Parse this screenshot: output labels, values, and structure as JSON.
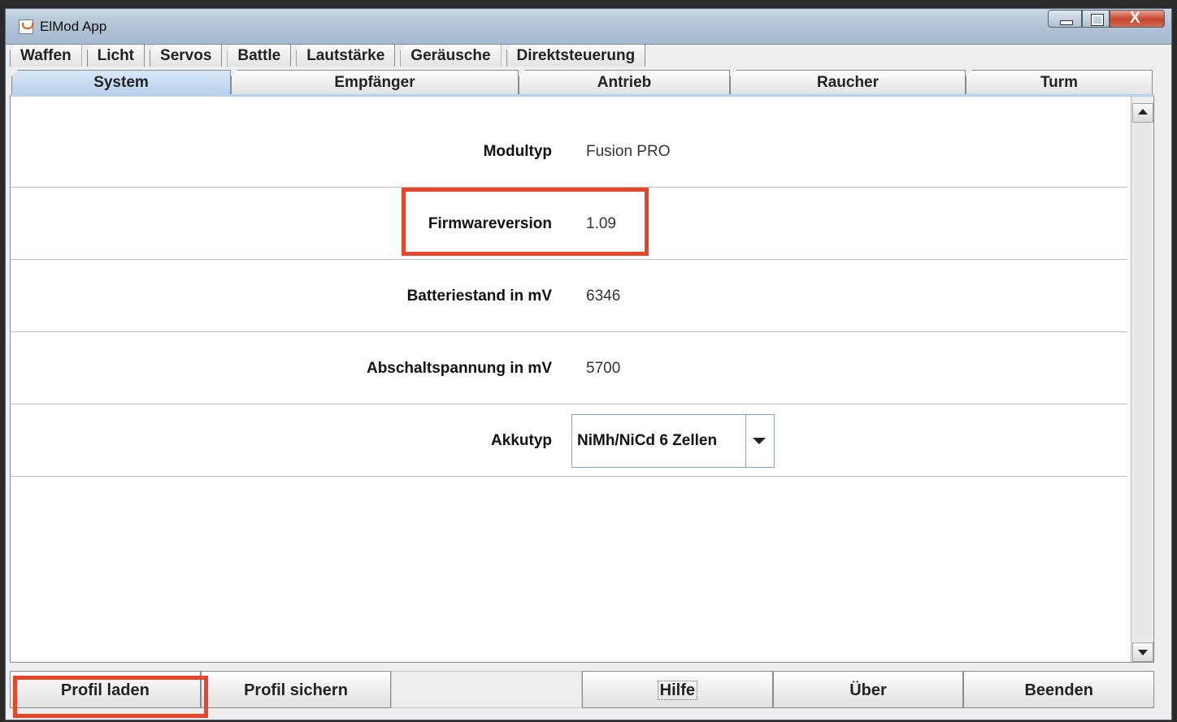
{
  "window": {
    "title": "ElMod App"
  },
  "tabs_row1": [
    "Waffen",
    "Licht",
    "Servos",
    "Battle",
    "Lautstärke",
    "Geräusche",
    "Direktsteuerung"
  ],
  "tabs_row2": [
    "System",
    "Empfänger",
    "Antrieb",
    "Raucher",
    "Turm"
  ],
  "active_tab": "System",
  "system": {
    "modultyp_label": "Modultyp",
    "modultyp_value": "Fusion PRO",
    "firmware_label": "Firmwareversion",
    "firmware_value": "1.09",
    "battery_label": "Batteriestand in mV",
    "battery_value": "6346",
    "cutoff_label": "Abschaltspannung in mV",
    "cutoff_value": "5700",
    "akkutyp_label": "Akkutyp",
    "akkutyp_value": "NiMh/NiCd 6 Zellen"
  },
  "buttons": {
    "load": "Profil laden",
    "save": "Profil sichern",
    "help": "Hilfe",
    "about": "Über",
    "exit": "Beenden"
  },
  "colors": {
    "highlight": "#e8452a",
    "active_tab": "#b8d1ec"
  },
  "icons": [
    "java-app-icon",
    "minimize-icon",
    "maximize-icon",
    "close-icon",
    "chevron-down-icon",
    "scroll-up-icon",
    "scroll-down-icon"
  ]
}
